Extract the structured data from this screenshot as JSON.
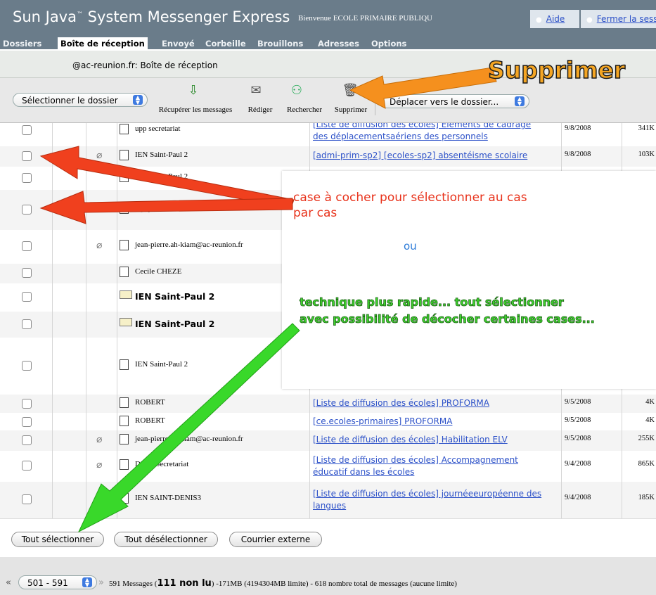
{
  "app": {
    "title": "Sun Java",
    "tm": "™",
    "title_rest": " System Messenger Express",
    "welcome": "Bienvenue ECOLE PRIMAIRE PUBLIQU",
    "links": [
      "Aide",
      "Fermer la sess"
    ]
  },
  "tabs": [
    "Dossiers",
    "Boîte de réception",
    "Envoyé",
    "Corbeille",
    "Brouillons",
    "Adresses",
    "Options"
  ],
  "location": "@ac-reunion.fr: Boîte de réception",
  "toolbar": {
    "folder_select": "Sélectionner le dossier",
    "buttons": [
      "Récupérer les messages",
      "Rédiger",
      "Rechercher",
      "Supprimer"
    ],
    "move_select": "Déplacer vers le dossier..."
  },
  "rows": [
    {
      "sender": "upp secretariat",
      "subject": [
        "[Liste de diffusion des écoles] Eléments de cadrage",
        "des déplacementsaériens des personnels"
      ],
      "date": "9/8/2008",
      "size": "341K"
    },
    {
      "sender": "IEN Saint-Paul 2",
      "subject": [
        "[admi-prim-sp2] [ecoles-sp2] absentéisme scolaire"
      ],
      "date": "9/8/2008",
      "size": "103K"
    },
    {
      "sender": "IEN Saint-Paul 2",
      "subject": [],
      "date": "",
      "size": ""
    },
    {
      "sender": "Dpep secretariat",
      "subject": [],
      "date": "",
      "size": ""
    },
    {
      "sender": "jean-pierre.ah-kiam@ac-reunion.fr",
      "subject": [],
      "date": "",
      "size": ""
    },
    {
      "sender": "Cecile CHEZE",
      "subject": [],
      "date": "",
      "size": ""
    },
    {
      "sender": "IEN Saint-Paul 2",
      "subject": [],
      "date": "",
      "size": ""
    },
    {
      "sender": "IEN Saint-Paul 2",
      "subject": [],
      "date": "",
      "size": ""
    },
    {
      "sender": "IEN Saint-Paul 2",
      "subject": [],
      "date": "",
      "size": ""
    },
    {
      "sender": "ROBERT",
      "subject": [
        "[Liste de diffusion des écoles] PROFORMA"
      ],
      "date": "9/5/2008",
      "size": "4K"
    },
    {
      "sender": "ROBERT",
      "subject": [
        "[ce.ecoles-primaires] PROFORMA"
      ],
      "date": "9/5/2008",
      "size": "4K"
    },
    {
      "sender": "jean-pierre.ah-kiam@ac-reunion.fr",
      "subject": [
        "[Liste de diffusion des écoles] Habilitation ELV"
      ],
      "date": "9/5/2008",
      "size": "255K"
    },
    {
      "sender": "DPEP Secretariat",
      "subject": [
        "[Liste de diffusion des écoles] Accompagnement",
        "éducatif dans les écoles"
      ],
      "date": "9/4/2008",
      "size": "865K"
    },
    {
      "sender": "IEN SAINT-DENIS3",
      "subject": [
        "[Liste de diffusion des écoles] journéeeuropéenne des",
        "langues"
      ],
      "date": "9/4/2008",
      "size": "185K"
    }
  ],
  "buttons": {
    "select_all": "Tout sélectionner",
    "deselect_all": "Tout désélectionner",
    "external_mail": "Courrier externe"
  },
  "footer": {
    "range": "501 - 591",
    "prefix": "591 Messages (",
    "unread": "111 non lu",
    "suffix": ") -171MB (4194304MB limite) - 618 nombre total de messages (aucune limite)"
  },
  "annotations": {
    "supprimer": "Supprimer",
    "case_line1": "case à cocher pour sélectionner au cas",
    "case_line2": "par cas",
    "ou": "ou",
    "tech_line1": "technique plus rapide... tout sélectionner",
    "tech_line2": "avec possibilité de décocher certaines cases..."
  },
  "colors": {
    "banner": "#6a7c8a",
    "link": "#2b50c8",
    "orange_arrow": "#f5901e",
    "red_arrow": "#f0401e",
    "green_arrow": "#39d82a"
  }
}
